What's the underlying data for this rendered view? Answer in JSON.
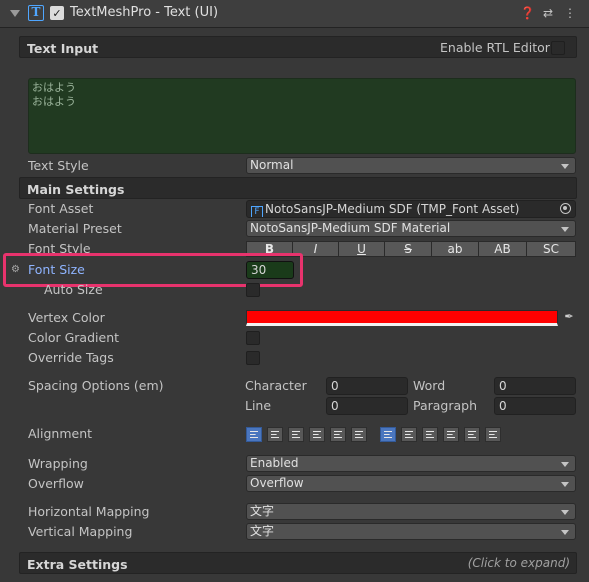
{
  "header": {
    "title": "TextMeshPro - Text (UI)",
    "enabled": true,
    "icons": [
      "help-icon",
      "preset-icon",
      "more-icon"
    ]
  },
  "text_input": {
    "section_label": "Text Input",
    "rtl_label": "Enable RTL Editor",
    "content_lines": [
      "おはよう",
      "おはよう"
    ],
    "text_style_label": "Text Style",
    "text_style_value": "Normal"
  },
  "main_settings": {
    "section_label": "Main Settings",
    "font_asset_label": "Font Asset",
    "font_asset_value": "NotoSansJP-Medium SDF (TMP_Font Asset)",
    "material_preset_label": "Material Preset",
    "material_preset_value": "NotoSansJP-Medium SDF Material",
    "font_style_label": "Font Style",
    "font_style_buttons": [
      "B",
      "I",
      "U",
      "S",
      "ab",
      "AB",
      "SC"
    ],
    "font_size_label": "Font Size",
    "font_size_value": "30",
    "auto_size_label": "Auto Size",
    "vertex_color_label": "Vertex Color",
    "vertex_color": "#ff0000",
    "color_gradient_label": "Color Gradient",
    "override_tags_label": "Override Tags",
    "spacing_label": "Spacing Options (em)",
    "character_label": "Character",
    "character_value": "0",
    "word_label": "Word",
    "word_value": "0",
    "line_label": "Line",
    "line_value": "0",
    "paragraph_label": "Paragraph",
    "paragraph_value": "0",
    "alignment_label": "Alignment",
    "wrapping_label": "Wrapping",
    "wrapping_value": "Enabled",
    "overflow_label": "Overflow",
    "overflow_value": "Overflow",
    "horizontal_mapping_label": "Horizontal Mapping",
    "horizontal_mapping_value": "文字",
    "vertical_mapping_label": "Vertical Mapping",
    "vertical_mapping_value": "文字"
  },
  "extra_settings": {
    "section_label": "Extra Settings",
    "hint": "(Click to expand)"
  },
  "colors": {
    "highlight": "#e8336d",
    "accent": "#4a76bf",
    "text_area_bg": "#213a21"
  }
}
